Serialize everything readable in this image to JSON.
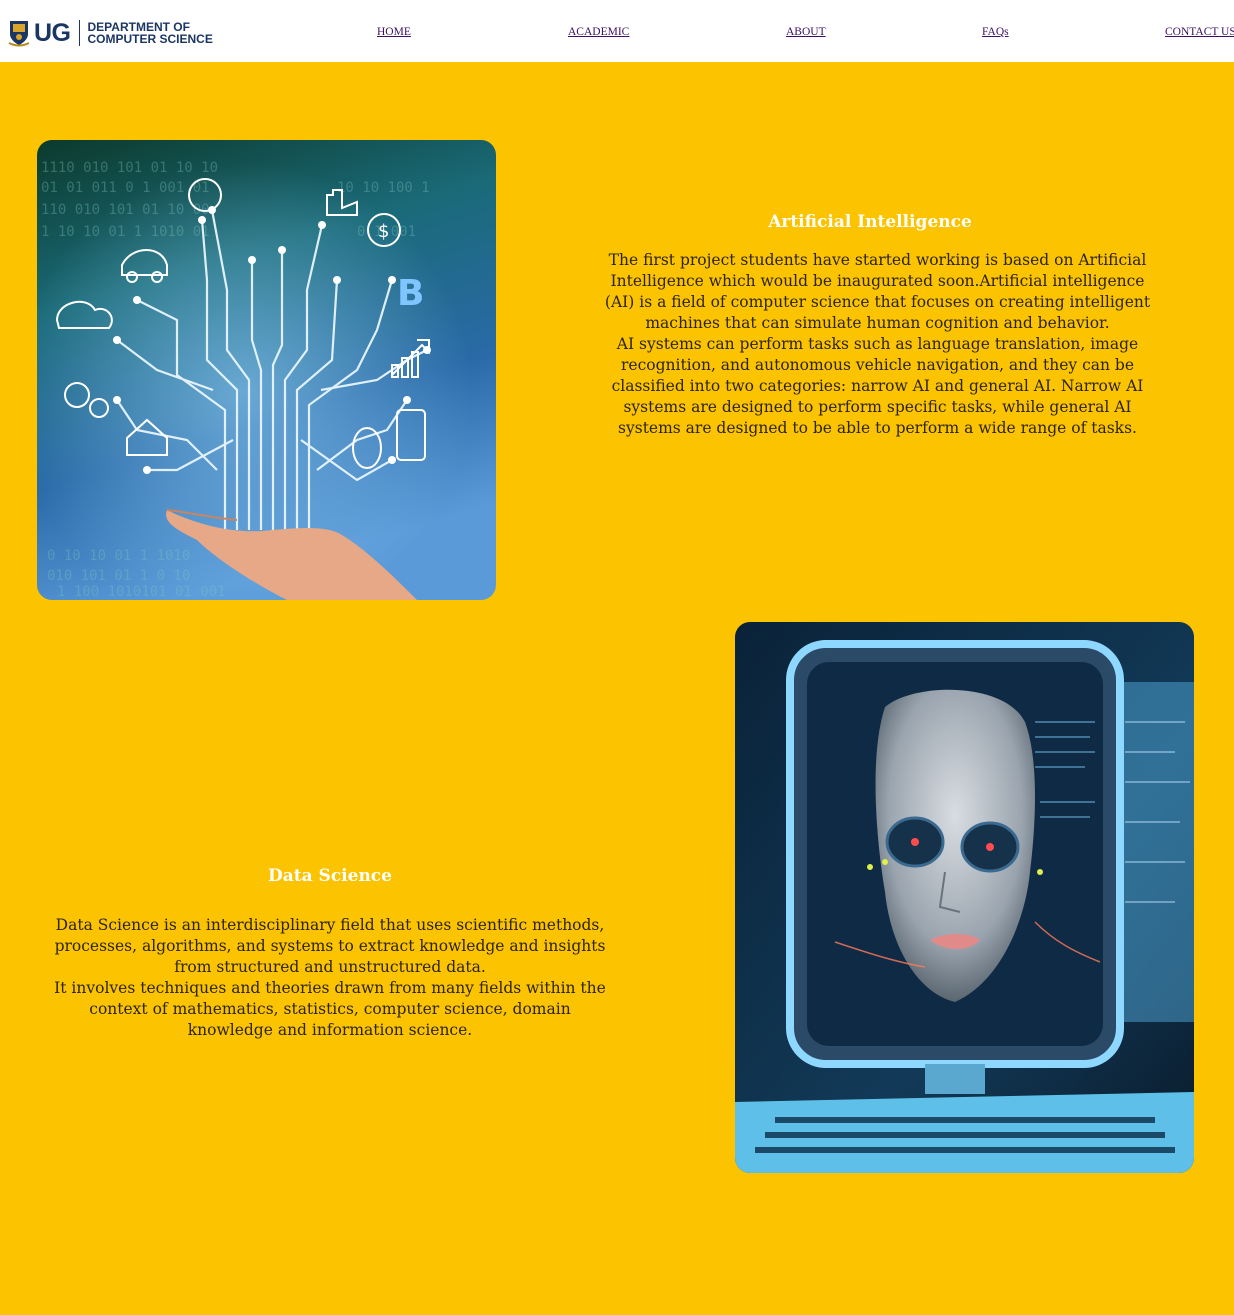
{
  "header": {
    "logo_short": "UG",
    "logo_line1": "DEPARTMENT OF",
    "logo_line2": "COMPUTER SCIENCE",
    "nav": [
      "HOME",
      "ACADEMIC",
      "ABOUT",
      "FAQs",
      "CONTACT US"
    ]
  },
  "sections": [
    {
      "title": "Artificial Intelligence",
      "paragraphs": [
        "The first project students have started working is based on Artificial Intelligence which would be inaugurated soon.Artificial intelligence (AI) is a field of computer science that focuses on creating intelligent machines that can simulate human cognition and behavior.",
        "AI systems can perform tasks such as language translation, image recognition, and autonomous vehicle navigation, and they can be classified into two categories: narrow AI and general AI. Narrow AI systems are designed to perform specific tasks, while general AI systems are designed to be able to perform a wide range of tasks."
      ]
    },
    {
      "title": "Data Science",
      "paragraphs": [
        "Data Science is an interdisciplinary field that uses scientific methods, processes, algorithms, and systems to extract knowledge and insights from structured and unstructured data.",
        "It involves techniques and theories drawn from many fields within the context of mathematics, statistics, computer science, domain knowledge and information science."
      ]
    }
  ],
  "colors": {
    "page_background": "#fcc400",
    "header_background": "#ffffff",
    "logo_blue": "#1c3664",
    "nav_link": "#3c0e64",
    "section_title": "#ffffff",
    "body_text": "#2d2418"
  }
}
